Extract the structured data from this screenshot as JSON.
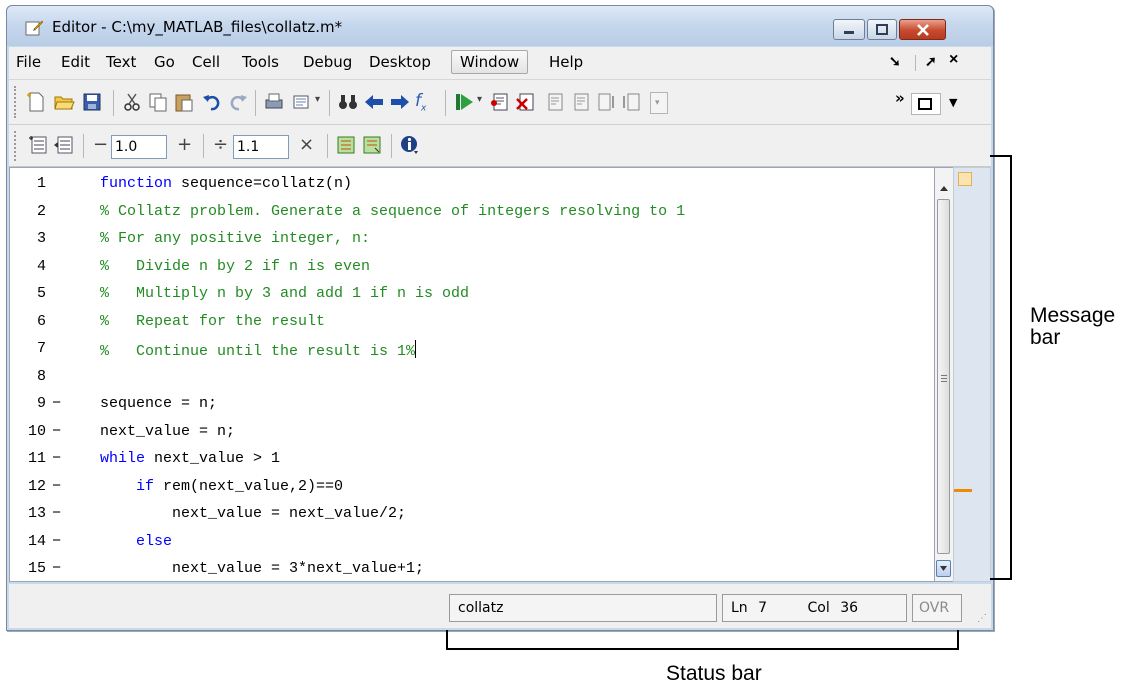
{
  "window": {
    "title": "Editor - C:\\my_MATLAB_files\\collatz.m*"
  },
  "menu": {
    "items": [
      "File",
      "Edit",
      "Text",
      "Go",
      "Cell",
      "Tools",
      "Debug",
      "Desktop",
      "Window",
      "Help"
    ],
    "active": "Window"
  },
  "toolbar2": {
    "minus": "−",
    "plus": "+",
    "divide": "÷",
    "times": "×",
    "value1": "1.0",
    "value2": "1.1"
  },
  "code": {
    "lines": [
      {
        "num": "1",
        "dash": "",
        "kind": "function",
        "text": "function sequence=collatz(n)"
      },
      {
        "num": "2",
        "dash": "",
        "kind": "comment",
        "text": "% Collatz problem. Generate a sequence of integers resolving to 1"
      },
      {
        "num": "3",
        "dash": "",
        "kind": "comment",
        "text": "% For any positive integer, n:"
      },
      {
        "num": "4",
        "dash": "",
        "kind": "comment",
        "text": "%   Divide n by 2 if n is even"
      },
      {
        "num": "5",
        "dash": "",
        "kind": "comment",
        "text": "%   Multiply n by 3 and add 1 if n is odd"
      },
      {
        "num": "6",
        "dash": "",
        "kind": "comment",
        "text": "%   Repeat for the result"
      },
      {
        "num": "7",
        "dash": "",
        "kind": "comment",
        "text": "%   Continue until the result is 1%"
      },
      {
        "num": "8",
        "dash": "",
        "kind": "blank",
        "text": ""
      },
      {
        "num": "9",
        "dash": "−",
        "kind": "plain",
        "text": "sequence = n;"
      },
      {
        "num": "10",
        "dash": "−",
        "kind": "plain",
        "text": "next_value = n;"
      },
      {
        "num": "11",
        "dash": "−",
        "kind": "while",
        "text": "while next_value > 1"
      },
      {
        "num": "12",
        "dash": "−",
        "kind": "if",
        "text": "    if rem(next_value,2)==0"
      },
      {
        "num": "13",
        "dash": "−",
        "kind": "plain",
        "text": "        next_value = next_value/2;"
      },
      {
        "num": "14",
        "dash": "−",
        "kind": "else",
        "text": "    else"
      },
      {
        "num": "15",
        "dash": "−",
        "kind": "plain",
        "text": "        next_value = 3*next_value+1;"
      }
    ]
  },
  "status": {
    "function_name": "collatz",
    "ln_label": "Ln",
    "ln_value": "7",
    "col_label": "Col",
    "col_value": "36",
    "ovr": "OVR"
  },
  "annotations": {
    "message_bar_line1": "Message",
    "message_bar_line2": "bar",
    "status_bar": "Status bar"
  },
  "colors": {
    "keyword": "#0000ff",
    "comment": "#228b22",
    "marker": "#f08a00"
  }
}
